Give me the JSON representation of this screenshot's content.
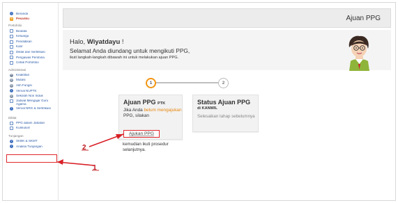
{
  "sidebar": {
    "top_items": [
      {
        "label": "Beranda",
        "icon": "home-icon"
      },
      {
        "label": "Pesanku",
        "icon": "message-icon",
        "active": true
      }
    ],
    "sections": [
      {
        "title": "Portofolio",
        "items": [
          {
            "label": "Biodata",
            "icon": "document-icon"
          },
          {
            "label": "Keluarga",
            "icon": "document-icon"
          },
          {
            "label": "Pendidikan",
            "icon": "document-icon"
          },
          {
            "label": "Karir",
            "icon": "document-icon"
          },
          {
            "label": "Diklat dan Sertifikasi",
            "icon": "document-icon"
          },
          {
            "label": "Pengawas Pembina",
            "icon": "document-icon"
          },
          {
            "label": "Cetak Portofolio",
            "icon": "document-icon"
          }
        ]
      },
      {
        "title": "Administrasi",
        "items": [
          {
            "label": "Keaktifan",
            "icon": "gear-icon"
          },
          {
            "label": "Mutasi",
            "icon": "gear-icon"
          },
          {
            "label": "Alih Fungsi",
            "icon": "gear-icon"
          },
          {
            "label": "Verval NUPTK",
            "icon": "info-icon"
          },
          {
            "label": "Sekolah Non Induk",
            "icon": "gear-icon"
          },
          {
            "label": "Jadwal Mengajar Guru Agama",
            "icon": "document-icon"
          },
          {
            "label": "Verval NRG & Sertifikasi",
            "icon": "info-icon"
          }
        ]
      },
      {
        "title": "Diklat",
        "items": [
          {
            "label": "PPG dalam Jabatan",
            "icon": "document-icon"
          },
          {
            "label": "Kurikulum",
            "icon": "document-icon"
          }
        ]
      },
      {
        "title": "Tunjangan",
        "items": [
          {
            "label": "SKBK & SKMT",
            "icon": "info-icon"
          },
          {
            "label": "Analisa Tunjangan",
            "icon": "info-icon"
          }
        ]
      }
    ]
  },
  "header": {
    "title": "Ajuan PPG"
  },
  "greeting": {
    "hello_prefix": "Halo, ",
    "name": "Wiyatdayu",
    "hello_suffix": " !",
    "line1": "Selamat Anda diundang untuk mengikuti PPG,",
    "line2": "ikuti langkah-langkah dibawah ini untuk melakukan ajuan PPG."
  },
  "steps": [
    "1",
    "2"
  ],
  "card1": {
    "title": "Ajuan PPG",
    "title_tag": "PTK",
    "text_a": "Jika Anda ",
    "text_highlight": "belum mengajukan",
    "text_b": " PPG, silakan",
    "button_label": "Ajukan PPG",
    "after_text": "kemudian ikuti prosedur selanjutnya."
  },
  "card2": {
    "title": "Status Ajuan PPG",
    "subtitle": "di KANWIL",
    "body": "Selesaikan tahap sebelumnya"
  },
  "annotations": [
    "1",
    "2"
  ],
  "colors": {
    "accent_orange": "#f29512",
    "highlight_red": "#e0262b",
    "link_blue": "#2a5aa8"
  }
}
